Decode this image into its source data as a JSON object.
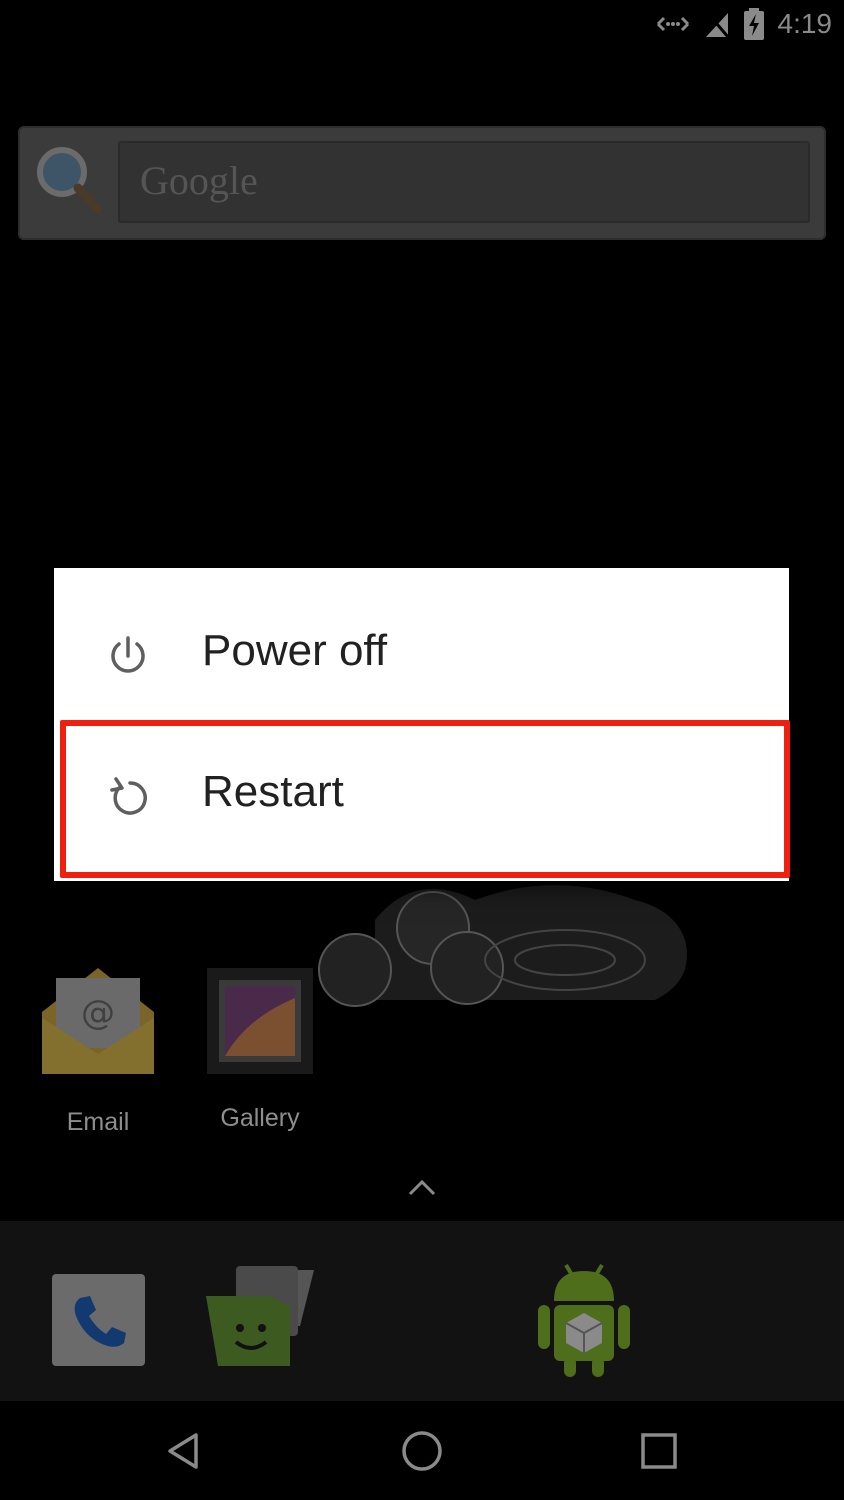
{
  "status_bar": {
    "time": "4:19",
    "icons": [
      "data-transfer-icon",
      "no-signal-icon",
      "battery-charging-icon"
    ]
  },
  "home": {
    "search_widget": {
      "placeholder": "Google",
      "icon": "search-icon"
    },
    "apps": [
      {
        "label": "Email",
        "icon": "email-icon"
      },
      {
        "label": "Gallery",
        "icon": "gallery-icon"
      }
    ],
    "drawer_handle_icon": "chevron-up-icon",
    "dock": [
      "phone-icon",
      "messaging-icon",
      "android-app-icon"
    ]
  },
  "power_dialog": {
    "items": [
      {
        "label": "Power off",
        "icon": "power-icon"
      },
      {
        "label": "Restart",
        "icon": "restart-icon",
        "highlighted": true
      }
    ],
    "highlight_color": "#f0200e"
  },
  "nav_bar": [
    "back-icon",
    "home-icon",
    "recents-icon"
  ]
}
